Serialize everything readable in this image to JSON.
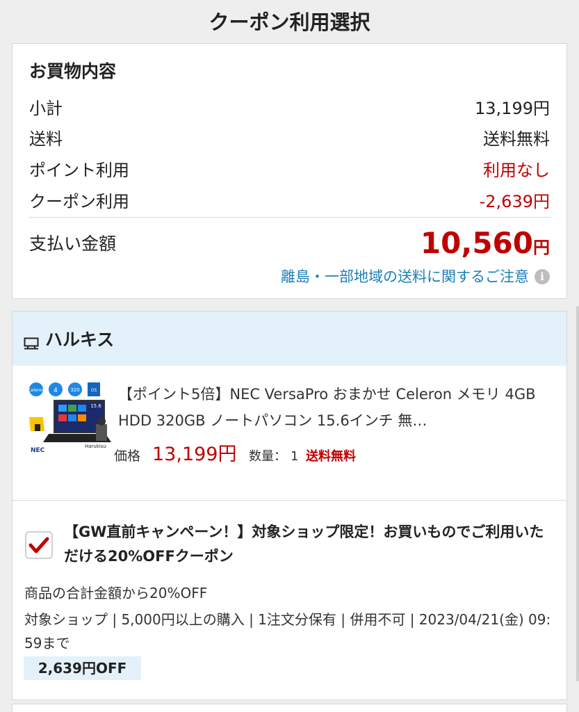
{
  "header": {
    "title": "クーポン利用選択"
  },
  "summary": {
    "heading": "お買物内容",
    "rows": [
      {
        "label": "小計",
        "value": "13,199円"
      },
      {
        "label": "送料",
        "value": "送料無料"
      },
      {
        "label": "ポイント利用",
        "value": "利用なし"
      },
      {
        "label": "クーポン利用",
        "value": "-2,639円"
      }
    ],
    "total": {
      "label": "支払い金額",
      "value": "10,560",
      "unit": "円"
    },
    "notice_link": "離島・一部地域の送料に関するご注意",
    "info_icon": "i"
  },
  "shop": {
    "icon": "shop-icon",
    "name": "ハルキス",
    "product": {
      "title": "【ポイント5倍】NEC VersaPro おまかせ Celeron メモリ 4GB HDD 320GB ノートパソコン 15.6インチ 無…",
      "price_label": "価格",
      "price": "13,199円",
      "qty_label": "数量：",
      "qty": "1",
      "shipping": "送料無料",
      "thumb": {
        "brand": "NEC",
        "badge_cpu": "Celeron",
        "badge_ram": "4",
        "badge_hdd": "320",
        "badge_os": "OS",
        "screen": "15.6",
        "seller_logo": "Harukisu"
      }
    }
  },
  "coupon": {
    "checked": true,
    "title": "【GW直前キャンペーン！】対象ショップ限定！お買いものでご利用いただける20%OFFクーポン",
    "description": "商品の合計金額から20%OFF",
    "conditions": "対象ショップ | 5,000円以上の購入 | 1注文分保有 | 併用不可 | 2023/04/21(金) 09:59まで",
    "discount": "2,639円OFF"
  },
  "colors": {
    "accent_red": "#bf0000",
    "link_blue": "#1a7fb8",
    "shop_header_bg": "#e3f1fa",
    "page_bg": "#eeeeee"
  }
}
